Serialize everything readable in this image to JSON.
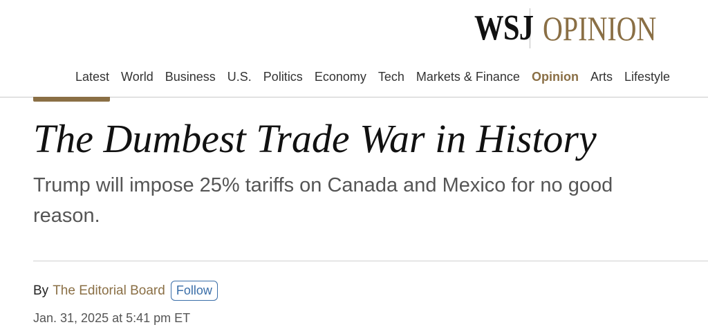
{
  "masthead": {
    "brand": "WSJ",
    "section": "OPINION"
  },
  "nav": {
    "items": [
      "Latest",
      "World",
      "Business",
      "U.S.",
      "Politics",
      "Economy",
      "Tech",
      "Markets & Finance",
      "Opinion",
      "Arts",
      "Lifestyle"
    ],
    "active": "Opinion"
  },
  "article": {
    "headline": "The Dumbest Trade War in History",
    "dek": "Trump will impose 25% tariffs on Canada and Mexico for no good reason.",
    "byline_prefix": "By",
    "author": "The Editorial Board",
    "follow_label": "Follow",
    "timestamp": "Jan. 31, 2025 at 5:41 pm ET"
  },
  "colors": {
    "accent": "#8a6f45",
    "follow": "#3a6ea8"
  }
}
